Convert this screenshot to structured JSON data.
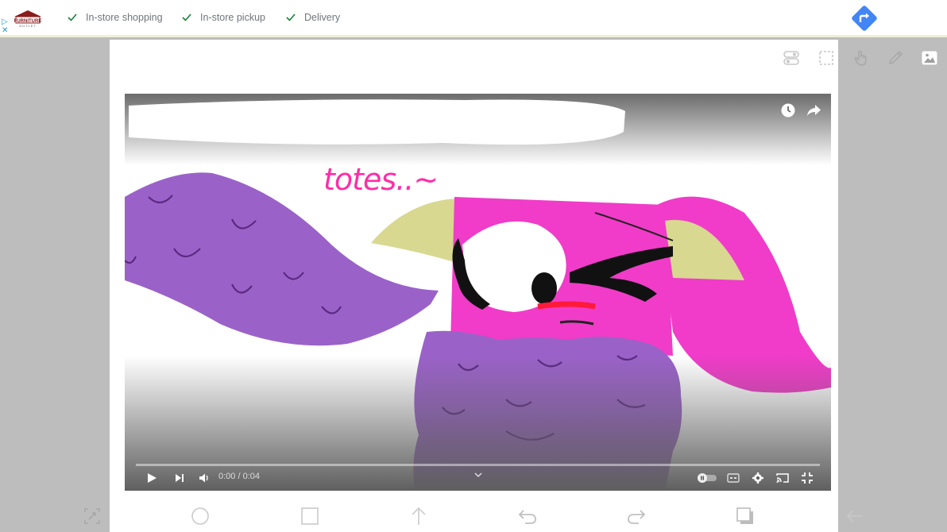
{
  "ad": {
    "features": [
      {
        "label": "In-store shopping",
        "icon": "checkmark-icon"
      },
      {
        "label": "In-store pickup",
        "icon": "checkmark-icon"
      },
      {
        "label": "Delivery",
        "icon": "checkmark-icon"
      }
    ],
    "logo_text": "FURNITURE",
    "logo_sub": "OUTLET",
    "directions_icon": "directions-icon",
    "accent": "#4285f4",
    "check_color": "#188038"
  },
  "video": {
    "time": "0:00 / 0:04",
    "progress": 0.0,
    "drawn_text": "totes..~"
  },
  "colors": {
    "pink": "#f03cc8",
    "purple": "#9a62c8",
    "horn": "#d8d890"
  }
}
